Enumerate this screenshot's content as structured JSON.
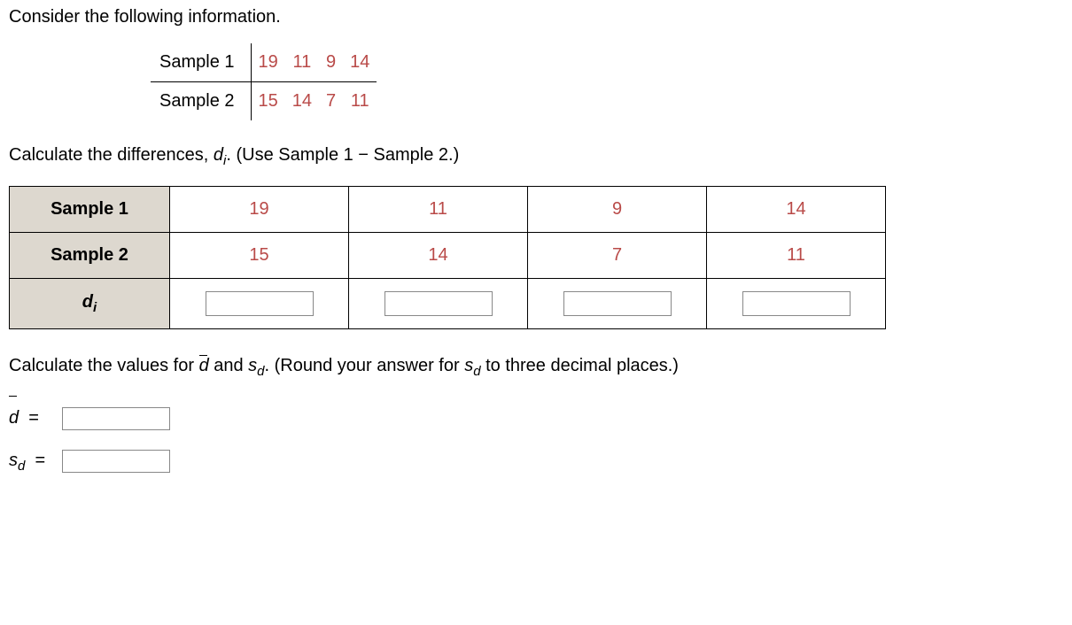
{
  "intro": "Consider the following information.",
  "sampleLabels": {
    "s1": "Sample 1",
    "s2": "Sample 2"
  },
  "samples": {
    "s1": [
      "19",
      "11",
      "9",
      "14"
    ],
    "s2": [
      "15",
      "14",
      "7",
      "11"
    ]
  },
  "calcDiffPrefix": "Calculate the differences, ",
  "calcDiffSuffix": " (Use Sample 1 − Sample 2.)",
  "diVar": "d",
  "diSub": "i",
  "tableHeaders": {
    "s1": "Sample 1",
    "s2": "Sample 2",
    "di": "d",
    "diSub": "i"
  },
  "tableVals": {
    "s1": [
      "19",
      "11",
      "9",
      "14"
    ],
    "s2": [
      "15",
      "14",
      "7",
      "11"
    ]
  },
  "calcValuesPrefix": "Calculate the values for ",
  "calcValuesMid": " and ",
  "calcValuesSuffix1": " (Round your answer for ",
  "calcValuesSuffix2": " to three decimal places.)",
  "sVar": "s",
  "dSub": "d",
  "dVarBar": "d",
  "eq": "=",
  "period": ".",
  "chart_data": {
    "type": "table",
    "samples": {
      "Sample 1": [
        19,
        11,
        9,
        14
      ],
      "Sample 2": [
        15,
        14,
        7,
        11
      ]
    }
  }
}
